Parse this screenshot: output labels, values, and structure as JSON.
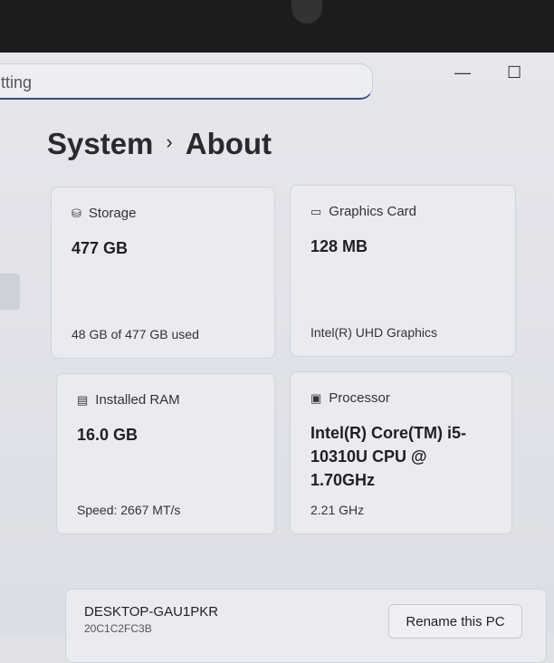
{
  "search": {
    "value": "tting"
  },
  "window": {
    "minimize": "—",
    "maximize": "☐"
  },
  "header": {
    "section": "System",
    "separator": "›",
    "page": "About"
  },
  "cards": [
    {
      "icon": "storage-icon",
      "glyph": "⛁",
      "label": "Storage",
      "value": "477 GB",
      "sub": "48 GB of 477 GB used"
    },
    {
      "icon": "graphics-card-icon",
      "glyph": "▭",
      "label": "Graphics Card",
      "value": "128 MB",
      "sub": "Intel(R) UHD Graphics"
    },
    {
      "icon": "ram-icon",
      "glyph": "▤",
      "label": "Installed RAM",
      "value": "16.0 GB",
      "sub": "Speed: 2667 MT/s"
    },
    {
      "icon": "processor-icon",
      "glyph": "▣",
      "label": "Processor",
      "value": "Intel(R) Core(TM) i5-10310U CPU @ 1.70GHz",
      "sub": "2.21 GHz"
    }
  ],
  "pc": {
    "name": "DESKTOP-GAU1PKR",
    "id": "20C1C2FC3B",
    "rename": "Rename this PC"
  }
}
